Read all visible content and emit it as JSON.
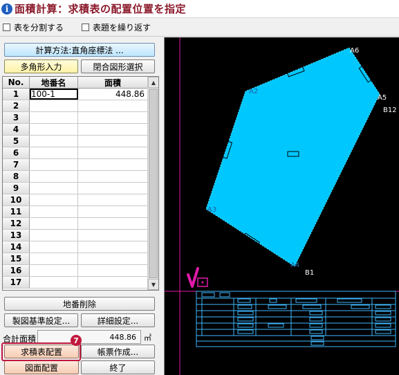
{
  "title": "面積計算：求積表の配置位置を指定",
  "options": [
    {
      "label": "表を分割する",
      "checked": false
    },
    {
      "label": "表題を繰り返す",
      "checked": false
    }
  ],
  "buttons": {
    "calc_method": "計算方法:直角座標法 ...",
    "polygon_input": "多角形入力",
    "closed_select": "閉合図形選択",
    "delete_lot": "地番削除",
    "drafting_settings": "製図基準設定...",
    "detail_settings": "詳細設定...",
    "place_table": "求積表配置",
    "create_form": "帳票作成...",
    "place_drawing": "図面配置",
    "finish": "終了"
  },
  "table": {
    "headers": [
      "No.",
      "地番名",
      "面積"
    ],
    "rows": [
      {
        "no": "1",
        "name": "100-1",
        "area": "448.86"
      },
      {
        "no": "2",
        "name": "",
        "area": ""
      },
      {
        "no": "3",
        "name": "",
        "area": ""
      },
      {
        "no": "4",
        "name": "",
        "area": ""
      },
      {
        "no": "5",
        "name": "",
        "area": ""
      },
      {
        "no": "6",
        "name": "",
        "area": ""
      },
      {
        "no": "7",
        "name": "",
        "area": ""
      },
      {
        "no": "8",
        "name": "",
        "area": ""
      },
      {
        "no": "9",
        "name": "",
        "area": ""
      },
      {
        "no": "10",
        "name": "",
        "area": ""
      },
      {
        "no": "11",
        "name": "",
        "area": ""
      },
      {
        "no": "12",
        "name": "",
        "area": ""
      },
      {
        "no": "13",
        "name": "",
        "area": ""
      },
      {
        "no": "14",
        "name": "",
        "area": ""
      },
      {
        "no": "15",
        "name": "",
        "area": ""
      },
      {
        "no": "16",
        "name": "",
        "area": ""
      },
      {
        "no": "17",
        "name": "",
        "area": ""
      }
    ]
  },
  "total": {
    "label": "合計面積",
    "value": "448.86",
    "unit": "㎡"
  },
  "step_badge": "7",
  "drawing": {
    "points": [
      {
        "label": "A6"
      },
      {
        "label": "A2"
      },
      {
        "label": "A5"
      },
      {
        "label": "B12"
      },
      {
        "label": "A3"
      },
      {
        "label": "A4"
      },
      {
        "label": "B1"
      }
    ],
    "polygon_color": "#00c8ff",
    "line_color": "#4fc8ff",
    "crosshair_color": "#e01aa8"
  }
}
